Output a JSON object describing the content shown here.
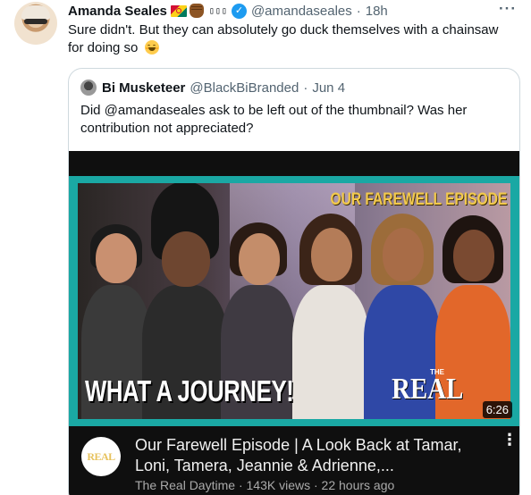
{
  "tweet": {
    "author_name": "Amanda Seales",
    "emoji_text": "▯▯▯",
    "handle": "@amandaseales",
    "time": "18h",
    "separator": "·",
    "more_label": "···",
    "text": "Sure didn't. But they can absolutely go duck themselves with a chainsaw for doing so"
  },
  "quoted": {
    "author_name": "Bi Musketeer",
    "handle": "@BlackBiBranded",
    "date": "Jun 4",
    "separator": "·",
    "text": "Did @amandaseales ask to be left out of the thumbnail? Was her contribution not appreciated?"
  },
  "video": {
    "banner_text": "OUR FAREWELL EPISODE",
    "overlay_text": "WHAT A JOURNEY!",
    "logo_the": "THE",
    "logo_real": "REAL",
    "duration": "6:26",
    "channel_logo_text": "REAL",
    "title": "Our Farewell Episode | A Look Back at Tamar, Loni, Tamera, Jeannie & Adrienne,...",
    "channel": "The Real Daytime",
    "views": "143K views",
    "age": "22 hours ago",
    "meta_separator": "·",
    "menu_label": "⋮"
  },
  "colors": {
    "verified": "#1d9bf0",
    "secondary_text": "#536471",
    "border": "#cfd9de",
    "thumb_frame": "#1aa8a4",
    "banner_text": "#f2c94c"
  }
}
